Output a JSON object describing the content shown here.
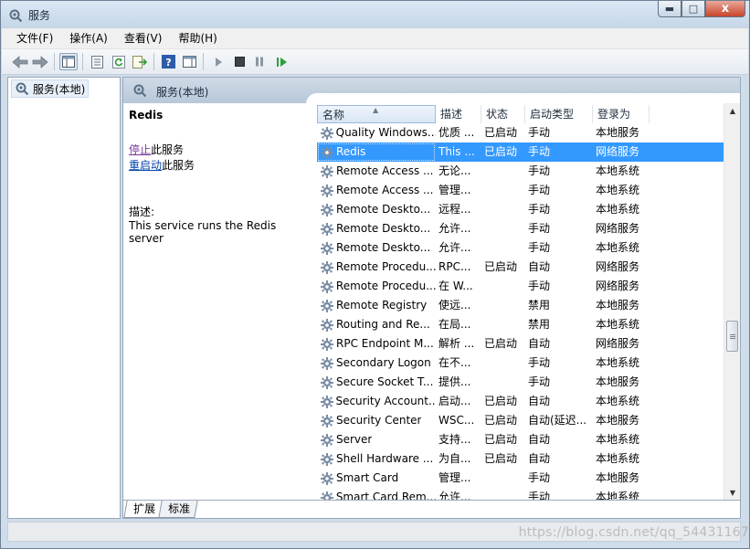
{
  "window": {
    "title": "服务",
    "minimize": "▬",
    "maximize": "□",
    "close": "x"
  },
  "menu": [
    {
      "label": "文件(F)"
    },
    {
      "label": "操作(A)"
    },
    {
      "label": "查看(V)"
    },
    {
      "label": "帮助(H)"
    }
  ],
  "toolbar": {
    "icons": [
      "back-arrow-icon",
      "forward-arrow-icon",
      "console-tree-icon",
      "properties-icon",
      "refresh-icon",
      "export-list-icon",
      "help-icon",
      "action-pane-icon",
      "start-service-icon",
      "stop-service-icon",
      "pause-service-icon",
      "restart-service-icon"
    ]
  },
  "tree": {
    "root_label": "服务(本地)"
  },
  "pane": {
    "header_title": "服务(本地)",
    "selected_name": "Redis",
    "stop_link": "停止",
    "stop_suffix": "此服务",
    "restart_link": "重启动",
    "restart_suffix": "此服务",
    "desc_label": "描述:",
    "desc_text": "This service runs the Redis server"
  },
  "list": {
    "columns": {
      "name": "名称",
      "desc": "描述",
      "status": "状态",
      "type": "启动类型",
      "login": "登录为"
    },
    "rows": [
      {
        "name": "Quality Windows...",
        "desc": "优质 ...",
        "status": "已启动",
        "type": "手动",
        "login": "本地服务"
      },
      {
        "name": "Redis",
        "desc": "This ...",
        "status": "已启动",
        "type": "手动",
        "login": "网络服务"
      },
      {
        "name": "Remote Access ...",
        "desc": "无论...",
        "status": "",
        "type": "手动",
        "login": "本地系统"
      },
      {
        "name": "Remote Access ...",
        "desc": "管理...",
        "status": "",
        "type": "手动",
        "login": "本地系统"
      },
      {
        "name": "Remote Deskto...",
        "desc": "远程...",
        "status": "",
        "type": "手动",
        "login": "本地系统"
      },
      {
        "name": "Remote Deskto...",
        "desc": "允许...",
        "status": "",
        "type": "手动",
        "login": "网络服务"
      },
      {
        "name": "Remote Deskto...",
        "desc": "允许...",
        "status": "",
        "type": "手动",
        "login": "本地系统"
      },
      {
        "name": "Remote Procedu...",
        "desc": "RPC...",
        "status": "已启动",
        "type": "自动",
        "login": "网络服务"
      },
      {
        "name": "Remote Procedu...",
        "desc": "在 W...",
        "status": "",
        "type": "手动",
        "login": "网络服务"
      },
      {
        "name": "Remote Registry",
        "desc": "使远...",
        "status": "",
        "type": "禁用",
        "login": "本地服务"
      },
      {
        "name": "Routing and Re...",
        "desc": "在局...",
        "status": "",
        "type": "禁用",
        "login": "本地系统"
      },
      {
        "name": "RPC Endpoint M...",
        "desc": "解析 ...",
        "status": "已启动",
        "type": "自动",
        "login": "网络服务"
      },
      {
        "name": "Secondary Logon",
        "desc": "在不...",
        "status": "",
        "type": "手动",
        "login": "本地系统"
      },
      {
        "name": "Secure Socket T...",
        "desc": "提供...",
        "status": "",
        "type": "手动",
        "login": "本地服务"
      },
      {
        "name": "Security Account...",
        "desc": "启动...",
        "status": "已启动",
        "type": "自动",
        "login": "本地系统"
      },
      {
        "name": "Security Center",
        "desc": "WSC...",
        "status": "已启动",
        "type": "自动(延迟...",
        "login": "本地服务"
      },
      {
        "name": "Server",
        "desc": "支持...",
        "status": "已启动",
        "type": "自动",
        "login": "本地系统"
      },
      {
        "name": "Shell Hardware ...",
        "desc": "为自...",
        "status": "已启动",
        "type": "自动",
        "login": "本地系统"
      },
      {
        "name": "Smart Card",
        "desc": "管理...",
        "status": "",
        "type": "手动",
        "login": "本地服务"
      },
      {
        "name": "Smart Card Rem...",
        "desc": "允许...",
        "status": "",
        "type": "手动",
        "login": "本地系统"
      }
    ]
  },
  "tabs": {
    "extended": "扩展",
    "standard": "标准"
  },
  "watermark": "https://blog.csdn.net/qq_54431167"
}
